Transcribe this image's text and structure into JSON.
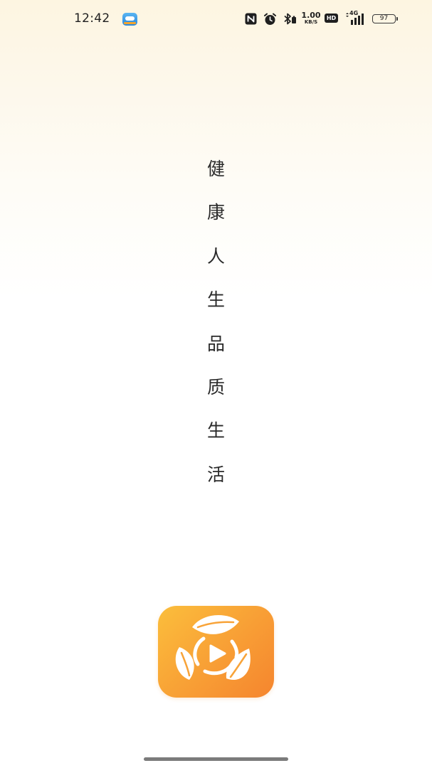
{
  "status_bar": {
    "time": "12:42",
    "notification_app_icon": "weather-app-icon",
    "icons": [
      "nfc-icon",
      "alarm-icon",
      "bluetooth-icon",
      "hd-voice-icon",
      "signal-4g-icon",
      "battery-icon"
    ],
    "net_speed_value": "1.00",
    "net_speed_unit": "KB/S",
    "hd_label": "HD",
    "network_type": "4G",
    "battery_level": "97"
  },
  "splash": {
    "slogan_chars": [
      "健",
      "康",
      "人",
      "生",
      "品",
      "质",
      "生",
      "活"
    ],
    "logo_icon": "leaves-play-logo-icon",
    "colors": {
      "logo_gradient_start": "#fbbe3c",
      "logo_gradient_end": "#f5852e",
      "background_top": "#fdf5e1",
      "text": "#2a2a2a"
    }
  }
}
